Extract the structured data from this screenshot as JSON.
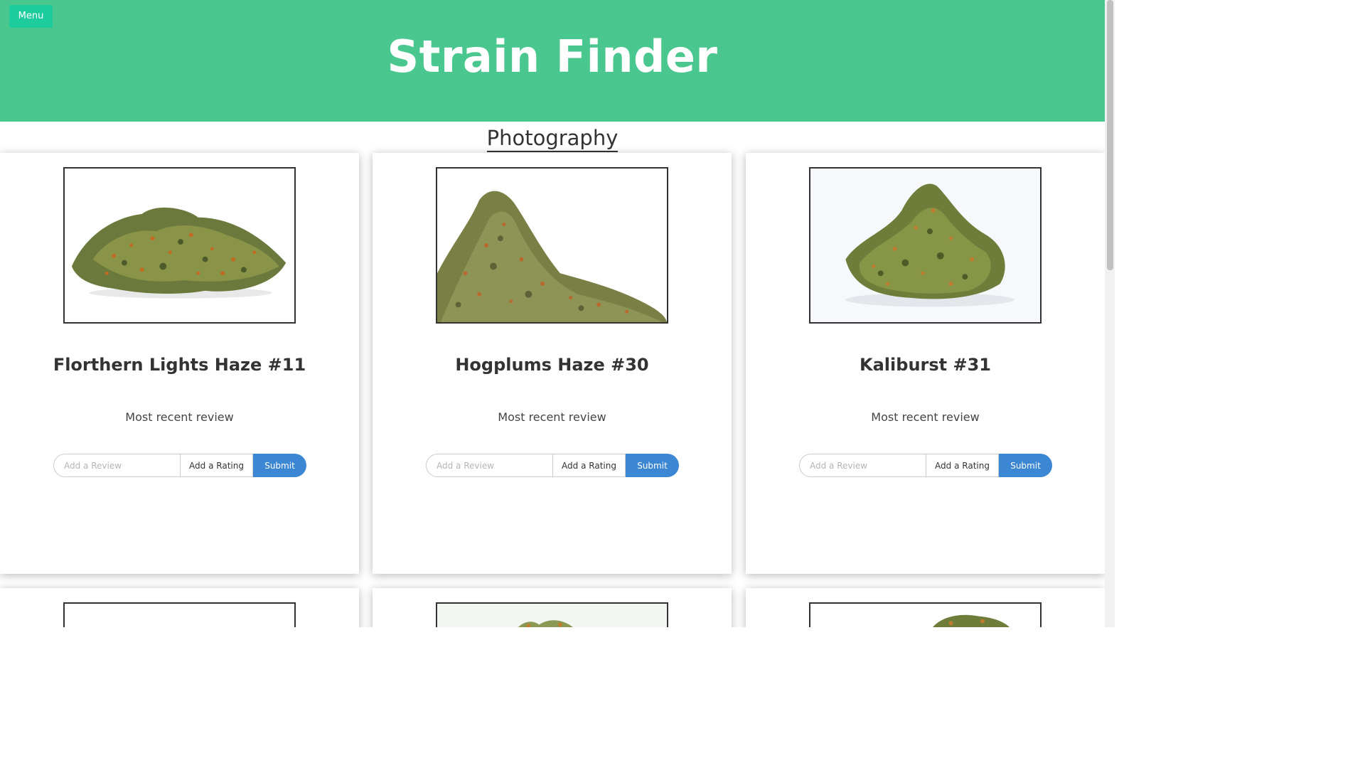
{
  "header": {
    "menu_label": "Menu",
    "title": "Strain Finder",
    "background_color": "#4ac78e",
    "menu_color": "#1dcc9d"
  },
  "section": {
    "title": "Photography"
  },
  "cards": [
    {
      "name": "Florthern Lights Haze #11",
      "review_label": "Most recent review",
      "review_placeholder": "Add a Review",
      "rating_label": "Add a Rating",
      "submit_label": "Submit",
      "image": "cannabis-bud-photo"
    },
    {
      "name": "Hogplums Haze #30",
      "review_label": "Most recent review",
      "review_placeholder": "Add a Review",
      "rating_label": "Add a Rating",
      "submit_label": "Submit",
      "image": "cannabis-bud-photo"
    },
    {
      "name": "Kaliburst #31",
      "review_label": "Most recent review",
      "review_placeholder": "Add a Review",
      "rating_label": "Add a Rating",
      "submit_label": "Submit",
      "image": "cannabis-bud-photo"
    }
  ],
  "colors": {
    "submit": "#3b87d3",
    "text": "#333333"
  }
}
